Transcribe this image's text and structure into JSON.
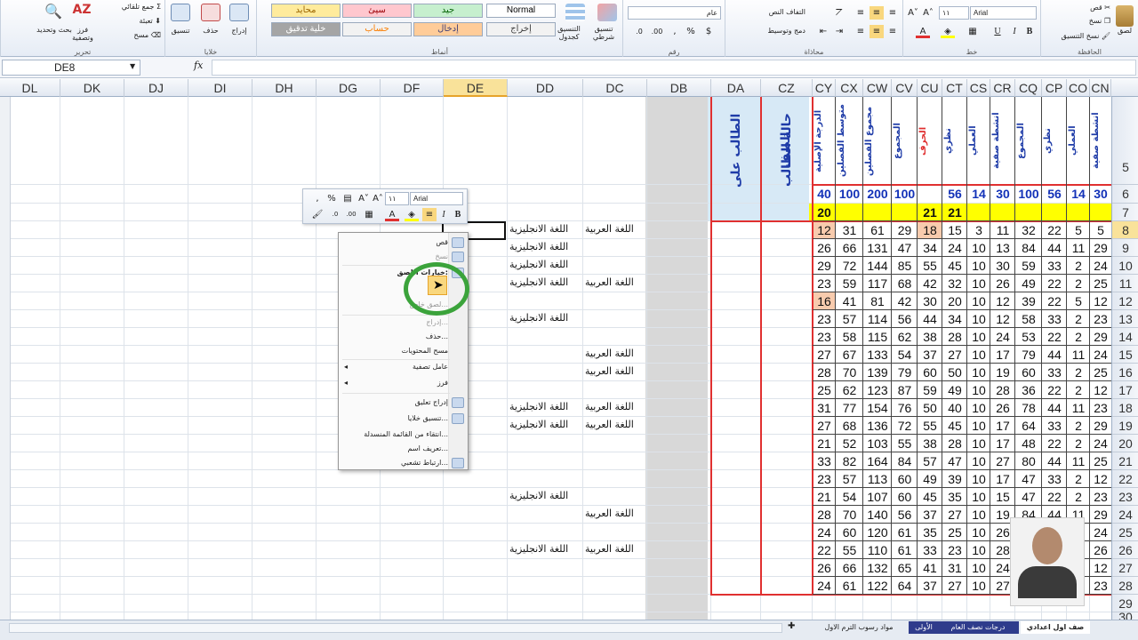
{
  "ribbon": {
    "clipboard": {
      "label": "الحافظة",
      "cut": "قص",
      "copy": "نسخ",
      "format_painter": "نسخ التنسيق",
      "paste": "لصق"
    },
    "font": {
      "label": "خط",
      "name": "Arial",
      "size": "١١"
    },
    "alignment": {
      "label": "محاذاة",
      "wrap": "التفاف النص",
      "merge": "دمج وتوسيط"
    },
    "number": {
      "label": "رقم",
      "format": "عام"
    },
    "styles": {
      "label": "أنماط",
      "cond_format": "تنسيق شرطي",
      "as_table": "التنسيق كجدول",
      "cells": [
        {
          "text": "Normal",
          "bg": "#ffffff",
          "fg": "#000000"
        },
        {
          "text": "جيد",
          "bg": "#c6efce",
          "fg": "#006100"
        },
        {
          "text": "سيئ",
          "bg": "#ffc7ce",
          "fg": "#9c0006"
        },
        {
          "text": "محايد",
          "bg": "#ffeb9c",
          "fg": "#9c6500"
        },
        {
          "text": "إخراج",
          "bg": "#f2f2f2",
          "fg": "#3f3f3f"
        },
        {
          "text": "إدخال",
          "bg": "#ffcc99",
          "fg": "#3f3f76"
        },
        {
          "text": "حساب",
          "bg": "#f2f2f2",
          "fg": "#fa7d00"
        },
        {
          "text": "خلية تدقيق",
          "bg": "#a5a5a5",
          "fg": "#ffffff"
        }
      ]
    },
    "cells_group": {
      "label": "خلايا",
      "insert": "إدراج",
      "delete": "حذف",
      "format": "تنسيق"
    },
    "editing": {
      "label": "تحرير",
      "autosum": "جمع تلقائي",
      "fill": "تعبئة",
      "clear": "مسح",
      "sort": "فرز وتصفية",
      "find": "بحث وتحديد"
    }
  },
  "formula_bar": {
    "name_box": "DE8",
    "fx": "fx",
    "content": ""
  },
  "columns": [
    {
      "n": "DL",
      "w": 68
    },
    {
      "n": "DK",
      "w": 72
    },
    {
      "n": "DJ",
      "w": 72
    },
    {
      "n": "DI",
      "w": 72
    },
    {
      "n": "DH",
      "w": 72
    },
    {
      "n": "DG",
      "w": 72
    },
    {
      "n": "DF",
      "w": 71
    },
    {
      "n": "DE",
      "w": 72,
      "active": true
    },
    {
      "n": "DD",
      "w": 85
    },
    {
      "n": "DC",
      "w": 72
    },
    {
      "n": "DB",
      "w": 72
    },
    {
      "n": "DA",
      "w": 56
    },
    {
      "n": "CZ",
      "w": 58
    },
    {
      "n": "CY",
      "w": 26
    },
    {
      "n": "CX",
      "w": 31
    },
    {
      "n": "CW",
      "w": 32
    },
    {
      "n": "CV",
      "w": 29
    },
    {
      "n": "CU",
      "w": 28
    },
    {
      "n": "CT",
      "w": 28
    },
    {
      "n": "CS",
      "w": 26
    },
    {
      "n": "CR",
      "w": 28
    },
    {
      "n": "CQ",
      "w": 30
    },
    {
      "n": "CP",
      "w": 28
    },
    {
      "n": "CO",
      "w": 26
    },
    {
      "n": "CN",
      "w": 24
    }
  ],
  "rows": [
    {
      "n": "5",
      "h": 99
    },
    {
      "n": "6",
      "h": 21
    },
    {
      "n": "7",
      "h": 20
    },
    {
      "n": "8",
      "h": 20,
      "active": true
    },
    {
      "n": "9",
      "h": 20
    },
    {
      "n": "10",
      "h": 20
    },
    {
      "n": "11",
      "h": 20
    },
    {
      "n": "12",
      "h": 20
    },
    {
      "n": "13",
      "h": 20
    },
    {
      "n": "14",
      "h": 20
    },
    {
      "n": "15",
      "h": 20
    },
    {
      "n": "16",
      "h": 20
    },
    {
      "n": "17",
      "h": 20
    },
    {
      "n": "18",
      "h": 20
    },
    {
      "n": "19",
      "h": 20
    },
    {
      "n": "20",
      "h": 20
    },
    {
      "n": "21",
      "h": 20
    },
    {
      "n": "22",
      "h": 20
    },
    {
      "n": "23",
      "h": 20
    },
    {
      "n": "24",
      "h": 20
    },
    {
      "n": "25",
      "h": 20
    },
    {
      "n": "26",
      "h": 20
    },
    {
      "n": "27",
      "h": 20
    },
    {
      "n": "28",
      "h": 20
    },
    {
      "n": "29",
      "h": 20
    },
    {
      "n": "30",
      "h": 10
    }
  ],
  "headers": {
    "da": "الطالب على الصف",
    "cz": "حالة الطالب",
    "vertical": [
      "الدرجة الإصلية",
      "متوسط الفصلين",
      "مجموع الفصلين",
      "المجموع",
      "الحرف",
      "نظري",
      "العملي",
      "انشطة صفية",
      "المجموع",
      "نظري",
      "العملي",
      "انشطة صفية"
    ],
    "max_row": [
      "40",
      "100",
      "200",
      "100",
      "",
      "56",
      "14",
      "30",
      "100",
      "56",
      "14",
      "30"
    ],
    "pass_row": [
      "20",
      "",
      "",
      "",
      "21",
      "21",
      "",
      "",
      "",
      "",
      "",
      ""
    ]
  },
  "data": [
    [
      "12",
      "31",
      "61",
      "29",
      "18",
      "15",
      "3",
      "11",
      "32",
      "22",
      "5",
      "5"
    ],
    [
      "26",
      "66",
      "131",
      "47",
      "34",
      "24",
      "10",
      "13",
      "84",
      "44",
      "11",
      "29"
    ],
    [
      "29",
      "72",
      "144",
      "85",
      "55",
      "45",
      "10",
      "30",
      "59",
      "33",
      "2",
      "24"
    ],
    [
      "23",
      "59",
      "117",
      "68",
      "42",
      "32",
      "10",
      "26",
      "49",
      "22",
      "2",
      "25"
    ],
    [
      "16",
      "41",
      "81",
      "42",
      "30",
      "20",
      "10",
      "12",
      "39",
      "22",
      "5",
      "12"
    ],
    [
      "23",
      "57",
      "114",
      "56",
      "44",
      "34",
      "10",
      "12",
      "58",
      "33",
      "2",
      "23"
    ],
    [
      "23",
      "58",
      "115",
      "62",
      "38",
      "28",
      "10",
      "24",
      "53",
      "22",
      "2",
      "29"
    ],
    [
      "27",
      "67",
      "133",
      "54",
      "37",
      "27",
      "10",
      "17",
      "79",
      "44",
      "11",
      "24"
    ],
    [
      "28",
      "70",
      "139",
      "79",
      "60",
      "50",
      "10",
      "19",
      "60",
      "33",
      "2",
      "25"
    ],
    [
      "25",
      "62",
      "123",
      "87",
      "59",
      "49",
      "10",
      "28",
      "36",
      "22",
      "2",
      "12"
    ],
    [
      "31",
      "77",
      "154",
      "76",
      "50",
      "40",
      "10",
      "26",
      "78",
      "44",
      "11",
      "23"
    ],
    [
      "27",
      "68",
      "136",
      "72",
      "55",
      "45",
      "10",
      "17",
      "64",
      "33",
      "2",
      "29"
    ],
    [
      "21",
      "52",
      "103",
      "55",
      "38",
      "28",
      "10",
      "17",
      "48",
      "22",
      "2",
      "24"
    ],
    [
      "33",
      "82",
      "164",
      "84",
      "57",
      "47",
      "10",
      "27",
      "80",
      "44",
      "11",
      "25"
    ],
    [
      "23",
      "57",
      "113",
      "60",
      "49",
      "39",
      "10",
      "17",
      "47",
      "33",
      "2",
      "12"
    ],
    [
      "21",
      "54",
      "107",
      "60",
      "45",
      "35",
      "10",
      "15",
      "47",
      "22",
      "2",
      "23"
    ],
    [
      "28",
      "70",
      "140",
      "56",
      "37",
      "27",
      "10",
      "19",
      "84",
      "44",
      "11",
      "29"
    ],
    [
      "24",
      "60",
      "120",
      "61",
      "35",
      "25",
      "10",
      "26",
      "",
      "",
      "",
      "24"
    ],
    [
      "22",
      "55",
      "110",
      "61",
      "33",
      "23",
      "10",
      "28",
      "",
      "",
      "",
      "26"
    ],
    [
      "26",
      "66",
      "132",
      "65",
      "41",
      "31",
      "10",
      "24",
      "",
      "",
      "",
      "12"
    ],
    [
      "24",
      "61",
      "122",
      "64",
      "37",
      "27",
      "10",
      "27",
      "",
      "",
      "",
      "23"
    ]
  ],
  "subjects": {
    "arabic": "اللغة العربية",
    "english": "اللغة الانجليزية",
    "dd_rows": [
      0,
      1,
      2,
      3,
      5,
      10,
      11,
      15,
      18
    ],
    "dc_rows": [
      0,
      3,
      7,
      8,
      10,
      11,
      16,
      18
    ]
  },
  "mini_toolbar": {
    "font": "Arial",
    "size": "١١",
    "bold": "B",
    "italic": "I",
    "percent": "%",
    "comma": ","
  },
  "context_menu": [
    {
      "label": "قص",
      "icon": "scissors-icon",
      "dis": false
    },
    {
      "label": "نسخ",
      "icon": "copy-icon",
      "dis": true
    },
    {
      "label": "خيارات اللصق:",
      "icon": "paste-icon",
      "dis": false,
      "bold": true
    },
    {
      "label": "لصق خاص...",
      "icon": "",
      "dis": true
    },
    {
      "label": "إدراج...",
      "icon": "",
      "dis": true
    },
    {
      "label": "حذف...",
      "icon": "",
      "dis": false
    },
    {
      "label": "مسح المحتويات",
      "icon": "",
      "dis": false
    },
    {
      "label": "عامل تصفية",
      "icon": "",
      "dis": false,
      "sub": true
    },
    {
      "label": "فرز",
      "icon": "",
      "dis": false,
      "sub": true
    },
    {
      "label": "إدراج تعليق",
      "icon": "comment-icon",
      "dis": false
    },
    {
      "label": "تنسيق خلايا...",
      "icon": "format-cells-icon",
      "dis": false
    },
    {
      "label": "انتقاء من القائمة المنسدلة...",
      "icon": "",
      "dis": false
    },
    {
      "label": "تعريف اسم...",
      "icon": "",
      "dis": false
    },
    {
      "label": "ارتباط تشعبي...",
      "icon": "hyperlink-icon",
      "dis": false
    }
  ],
  "sheet_tabs": [
    {
      "label": "صف اول اعدادي",
      "active": true
    },
    {
      "label": "درجات نصف العام",
      "active": false
    },
    {
      "label": "الأولى",
      "active": false
    },
    {
      "label": "مواد رسوب الترم الاول",
      "active": false
    }
  ],
  "colors": {
    "accent": "#e6a32a",
    "pass": "#ffff00",
    "low": "#f8cbad",
    "border_red": "#e03030",
    "header_blue": "#1f3ca8"
  }
}
